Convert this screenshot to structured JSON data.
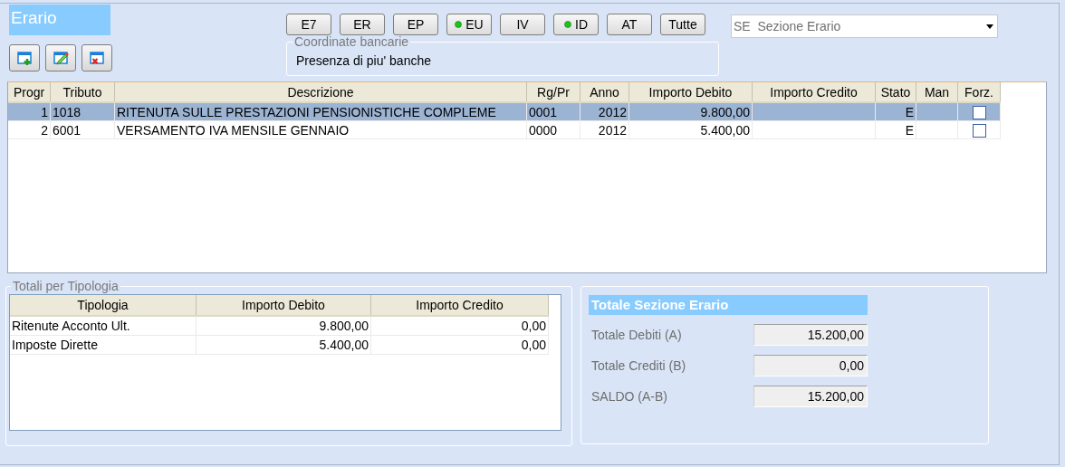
{
  "title": "Erario",
  "toolbar": [
    {
      "kind": "add"
    },
    {
      "kind": "edit"
    },
    {
      "kind": "delete"
    }
  ],
  "filters": [
    {
      "label": "E7",
      "indicator": false
    },
    {
      "label": "ER",
      "indicator": false
    },
    {
      "label": "EP",
      "indicator": false
    },
    {
      "label": "EU",
      "indicator": true
    },
    {
      "label": "IV",
      "indicator": false
    },
    {
      "label": "ID",
      "indicator": true
    },
    {
      "label": "AT",
      "indicator": false
    },
    {
      "label": "Tutte",
      "indicator": false
    }
  ],
  "section_select": {
    "value": "SE  Sezione Erario"
  },
  "bank_group": {
    "title": "Coordinate bancarie",
    "text": "Presenza di piu' banche"
  },
  "grid": {
    "columns": [
      "Progr",
      "Tributo",
      "Descrizione",
      "Rg/Pr",
      "Anno",
      "Importo Debito",
      "Importo Credito",
      "Stato",
      "Man",
      "Forz."
    ],
    "rows": [
      {
        "progr": "1",
        "tributo": "1018",
        "descrizione": "RITENUTA SULLE PRESTAZIONI PENSIONISTICHE COMPLEME",
        "rg_pr": "0001",
        "anno": "2012",
        "importo_debito": "9.800,00",
        "stato": "E",
        "forz": false,
        "selected": true
      },
      {
        "progr": "2",
        "tributo": "6001",
        "descrizione": "VERSAMENTO IVA MENSILE GENNAIO",
        "rg_pr": "0000",
        "anno": "2012",
        "importo_debito": "5.400,00",
        "stato": "E",
        "forz": false,
        "selected": false
      }
    ]
  },
  "totals_by_type": {
    "title": "Totali per Tipologia",
    "columns": [
      "Tipologia",
      "Importo Debito",
      "Importo Credito"
    ],
    "rows": [
      [
        "Ritenute Acconto Ult.",
        "9.800,00",
        "0,00"
      ],
      [
        "Imposte Dirette",
        "5.400,00",
        "0,00"
      ]
    ]
  },
  "section_total": {
    "title": "Totale Sezione Erario",
    "lines": [
      {
        "label": "Totale Debiti (A)",
        "value": "15.200,00"
      },
      {
        "label": "Totale Crediti (B)",
        "value": "0,00"
      },
      {
        "label": "SALDO (A-B)",
        "value": "15.200,00"
      }
    ]
  }
}
